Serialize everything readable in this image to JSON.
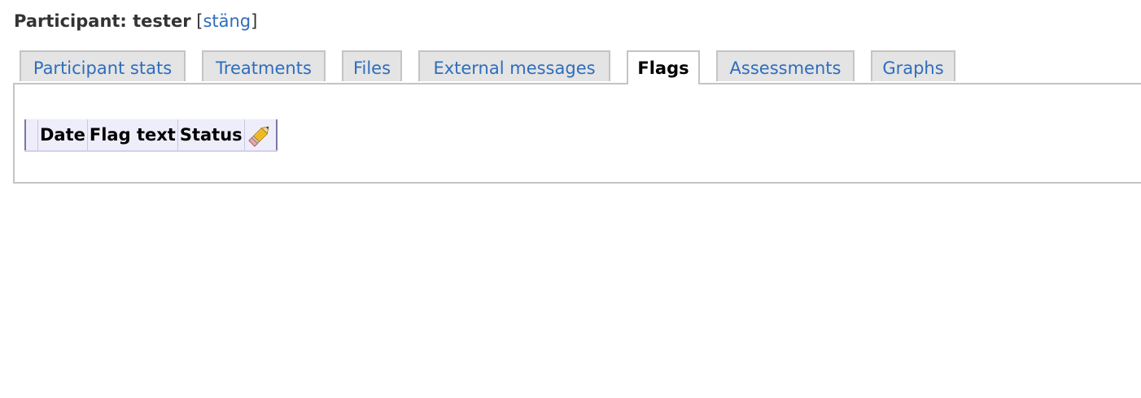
{
  "header": {
    "label": "Participant: tester",
    "bracket_open": "[",
    "close_link": "stäng",
    "bracket_close": "]"
  },
  "tabs": [
    {
      "label": "Participant stats",
      "active": false
    },
    {
      "label": "Treatments",
      "active": false
    },
    {
      "label": "Files",
      "active": false
    },
    {
      "label": "External messages",
      "active": false
    },
    {
      "label": "Flags",
      "active": true
    },
    {
      "label": "Assessments",
      "active": false
    },
    {
      "label": "Graphs",
      "active": false
    }
  ],
  "flags_table": {
    "columns": [
      "Date",
      "Flag text",
      "Status"
    ],
    "edit_icon": "pencil-icon"
  },
  "colors": {
    "link": "#2e6dbd",
    "tab_bg": "#e4e4e4",
    "table_border": "#7a78a8",
    "table_header_bg": "#eeedfa"
  }
}
